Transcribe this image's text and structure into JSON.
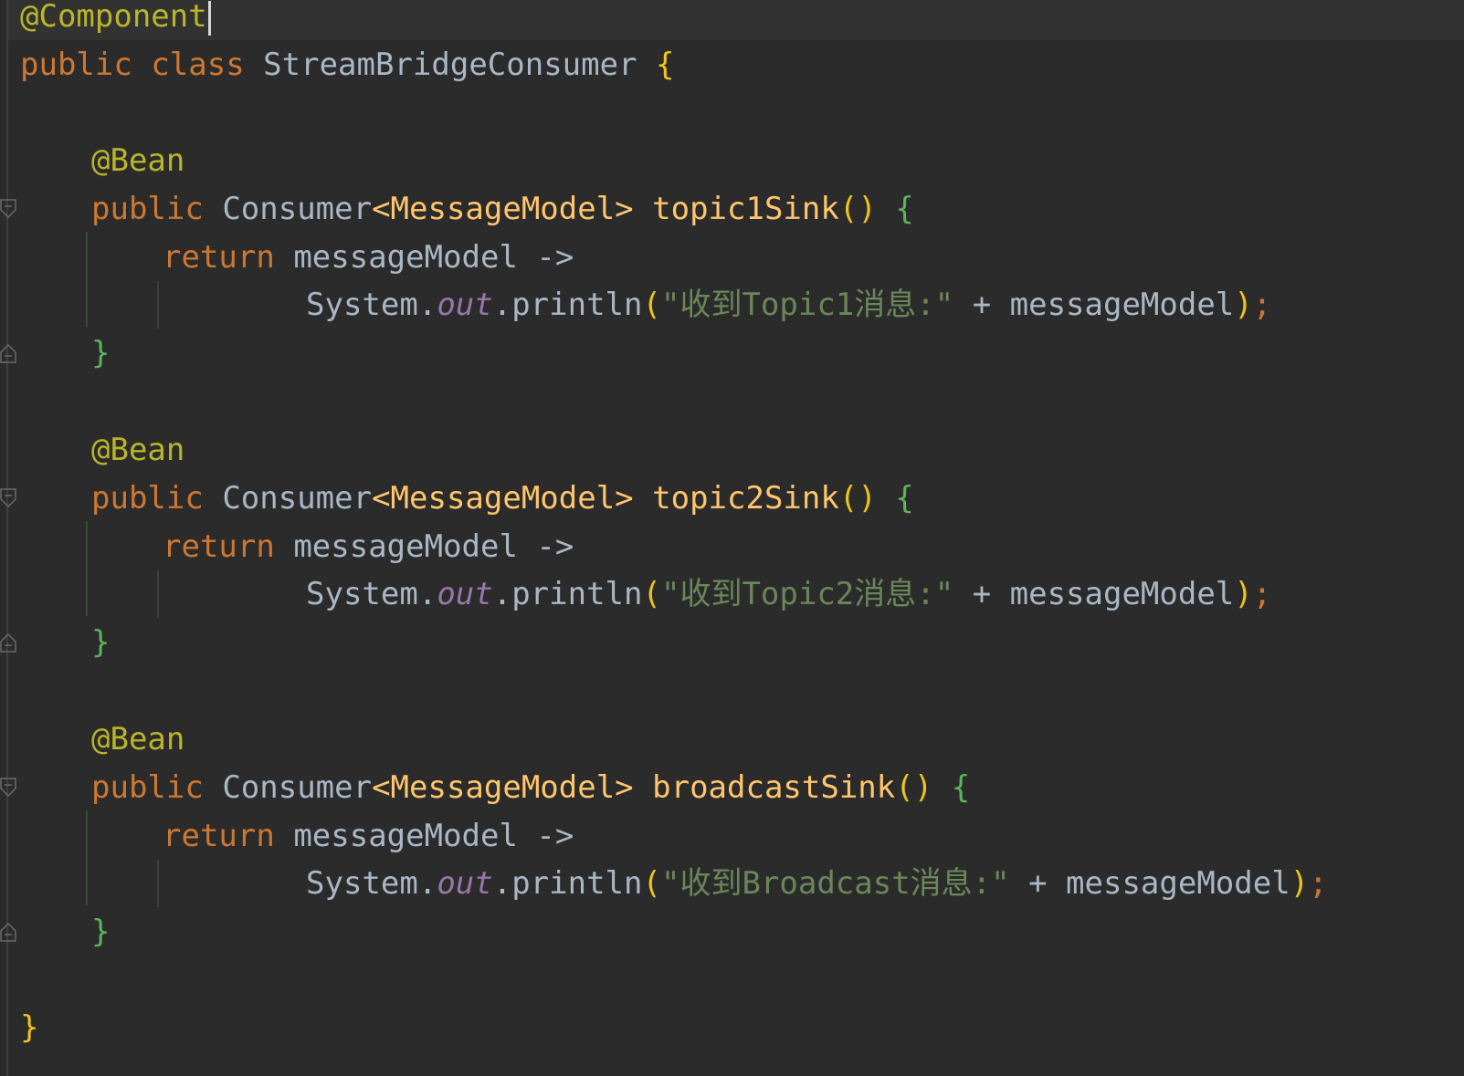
{
  "code": {
    "annotation_component": "@Component",
    "class_line": {
      "kw_public": "public",
      "kw_class": "class",
      "class_name": "StreamBridgeConsumer",
      "open_brace": "{"
    },
    "methods": [
      {
        "annotation": "@Bean",
        "kw_public": "public",
        "return_type": "Consumer",
        "generic": "<MessageModel>",
        "name": "topic1Sink",
        "parens": "()",
        "open_brace": "{",
        "kw_return": "return",
        "param": "messageModel ->",
        "system": "System",
        "out": "out",
        "println": ".println",
        "open_paren": "(",
        "string": "\"收到Topic1消息:\"",
        "concat": " + messageModel",
        "close": ")",
        "semicolon": ";",
        "close_brace": "}"
      },
      {
        "annotation": "@Bean",
        "kw_public": "public",
        "return_type": "Consumer",
        "generic": "<MessageModel>",
        "name": "topic2Sink",
        "parens": "()",
        "open_brace": "{",
        "kw_return": "return",
        "param": "messageModel ->",
        "system": "System",
        "out": "out",
        "println": ".println",
        "open_paren": "(",
        "string": "\"收到Topic2消息:\"",
        "concat": " + messageModel",
        "close": ")",
        "semicolon": ";",
        "close_brace": "}"
      },
      {
        "annotation": "@Bean",
        "kw_public": "public",
        "return_type": "Consumer",
        "generic": "<MessageModel>",
        "name": "broadcastSink",
        "parens": "()",
        "open_brace": "{",
        "kw_return": "return",
        "param": "messageModel ->",
        "system": "System",
        "out": "out",
        "println": ".println",
        "open_paren": "(",
        "string": "\"收到Broadcast消息:\"",
        "concat": " + messageModel",
        "close": ")",
        "semicolon": ";",
        "close_brace": "}"
      }
    ],
    "class_close_brace": "}"
  },
  "colors": {
    "background": "#2b2b2b",
    "keyword": "#cc7832",
    "annotation": "#bbb529",
    "method_name": "#ffc66d",
    "string": "#6a8759",
    "static_field": "#9876aa",
    "default_text": "#a9b7c6"
  },
  "icons": {
    "fold_open": "fold-open-icon",
    "fold_close": "fold-close-icon"
  }
}
